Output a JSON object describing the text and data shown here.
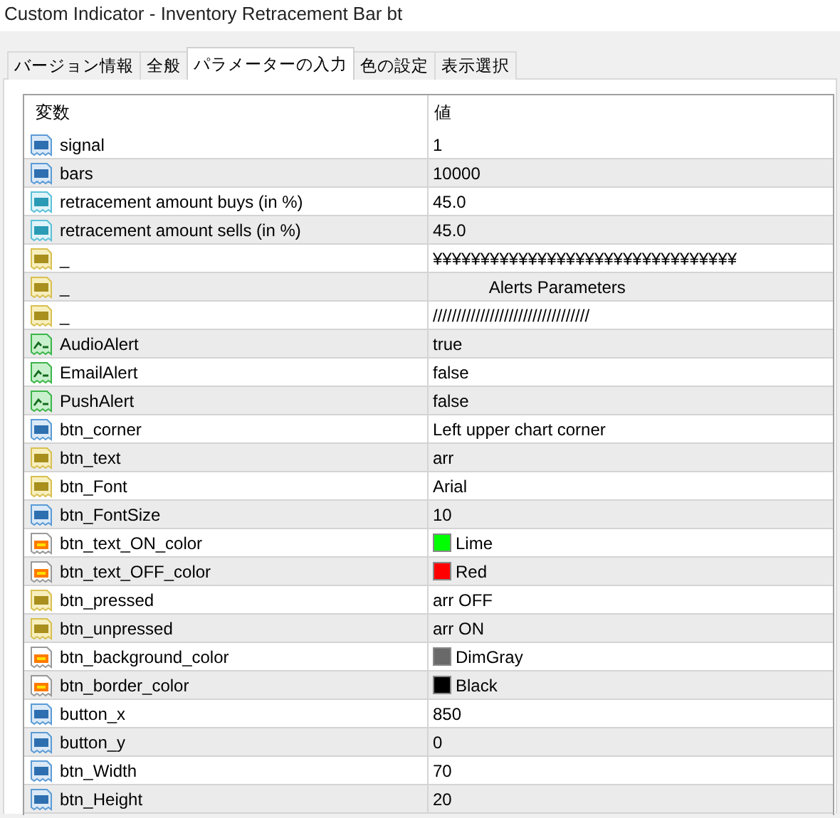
{
  "window": {
    "title": "Custom Indicator - Inventory Retracement Bar bt"
  },
  "tabs": [
    {
      "label": "バージョン情報",
      "selected": false
    },
    {
      "label": "全般",
      "selected": false
    },
    {
      "label": "パラメーターの入力",
      "selected": true
    },
    {
      "label": "色の設定",
      "selected": false
    },
    {
      "label": "表示選択",
      "selected": false
    }
  ],
  "table": {
    "columns": [
      "変数",
      "値"
    ],
    "rows": [
      {
        "kind": "int",
        "name": "signal",
        "value": "1"
      },
      {
        "kind": "int",
        "name": "bars",
        "value": "10000"
      },
      {
        "kind": "double",
        "name": "retracement amount buys (in %)",
        "value": "45.0"
      },
      {
        "kind": "double",
        "name": "retracement amount sells (in %)",
        "value": "45.0"
      },
      {
        "kind": "string",
        "name": "_",
        "value": "¥¥¥¥¥¥¥¥¥¥¥¥¥¥¥¥¥¥¥¥¥¥¥¥¥¥¥¥¥¥¥¥"
      },
      {
        "kind": "string",
        "name": "_",
        "value": "            Alerts Parameters"
      },
      {
        "kind": "string",
        "name": "_",
        "value": "/////////////////////////////////"
      },
      {
        "kind": "bool",
        "name": "AudioAlert",
        "value": "true"
      },
      {
        "kind": "bool",
        "name": "EmailAlert",
        "value": "false"
      },
      {
        "kind": "bool",
        "name": "PushAlert",
        "value": "false"
      },
      {
        "kind": "int",
        "name": "btn_corner",
        "value": "Left upper chart corner"
      },
      {
        "kind": "string",
        "name": "btn_text",
        "value": "arr"
      },
      {
        "kind": "string",
        "name": "btn_Font",
        "value": "Arial"
      },
      {
        "kind": "int",
        "name": "btn_FontSize",
        "value": "10"
      },
      {
        "kind": "color",
        "name": "btn_text_ON_color",
        "value": "Lime",
        "color": "#00ff00"
      },
      {
        "kind": "color",
        "name": "btn_text_OFF_color",
        "value": "Red",
        "color": "#ff0000"
      },
      {
        "kind": "string",
        "name": "btn_pressed",
        "value": "arr OFF"
      },
      {
        "kind": "string",
        "name": "btn_unpressed",
        "value": "arr ON"
      },
      {
        "kind": "color",
        "name": "btn_background_color",
        "value": "DimGray",
        "color": "#696969"
      },
      {
        "kind": "color",
        "name": "btn_border_color",
        "value": "Black",
        "color": "#000000"
      },
      {
        "kind": "int",
        "name": "button_x",
        "value": "850"
      },
      {
        "kind": "int",
        "name": "button_y",
        "value": "0"
      },
      {
        "kind": "int",
        "name": "btn_Width",
        "value": "70"
      },
      {
        "kind": "int",
        "name": "btn_Height",
        "value": "20"
      }
    ]
  }
}
